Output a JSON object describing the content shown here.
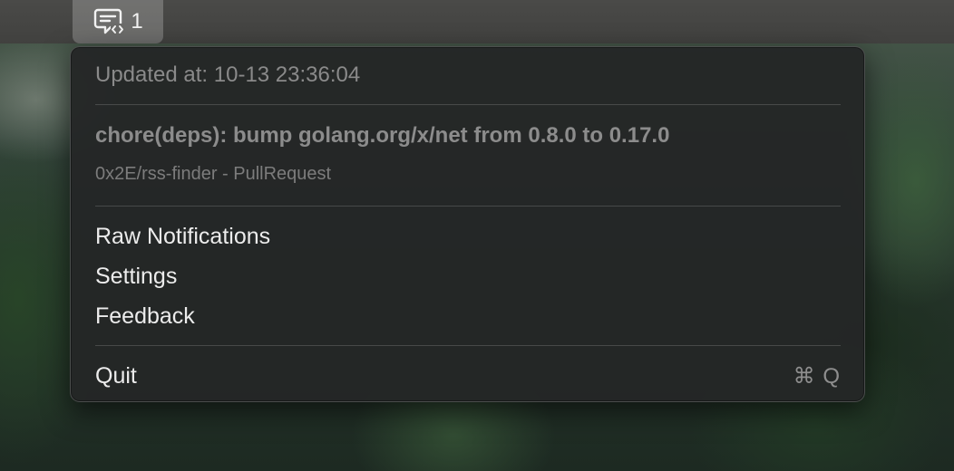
{
  "menubar": {
    "status_item": {
      "icon": "chat-bubble-code-icon",
      "count": "1"
    }
  },
  "menu": {
    "updated_at": "Updated at: 10-13 23:36:04",
    "notification": {
      "title": "chore(deps): bump golang.org/x/net from 0.8.0 to 0.17.0",
      "subtitle": "0x2E/rss-finder - PullRequest"
    },
    "items": [
      {
        "label": "Raw Notifications"
      },
      {
        "label": "Settings"
      },
      {
        "label": "Feedback"
      }
    ],
    "quit": {
      "label": "Quit",
      "shortcut": "⌘ Q"
    }
  },
  "colors": {
    "menu_background": "#242626",
    "menu_text": "#ececec",
    "disabled_text": "#8a8a8a",
    "menubar": "#454543"
  }
}
